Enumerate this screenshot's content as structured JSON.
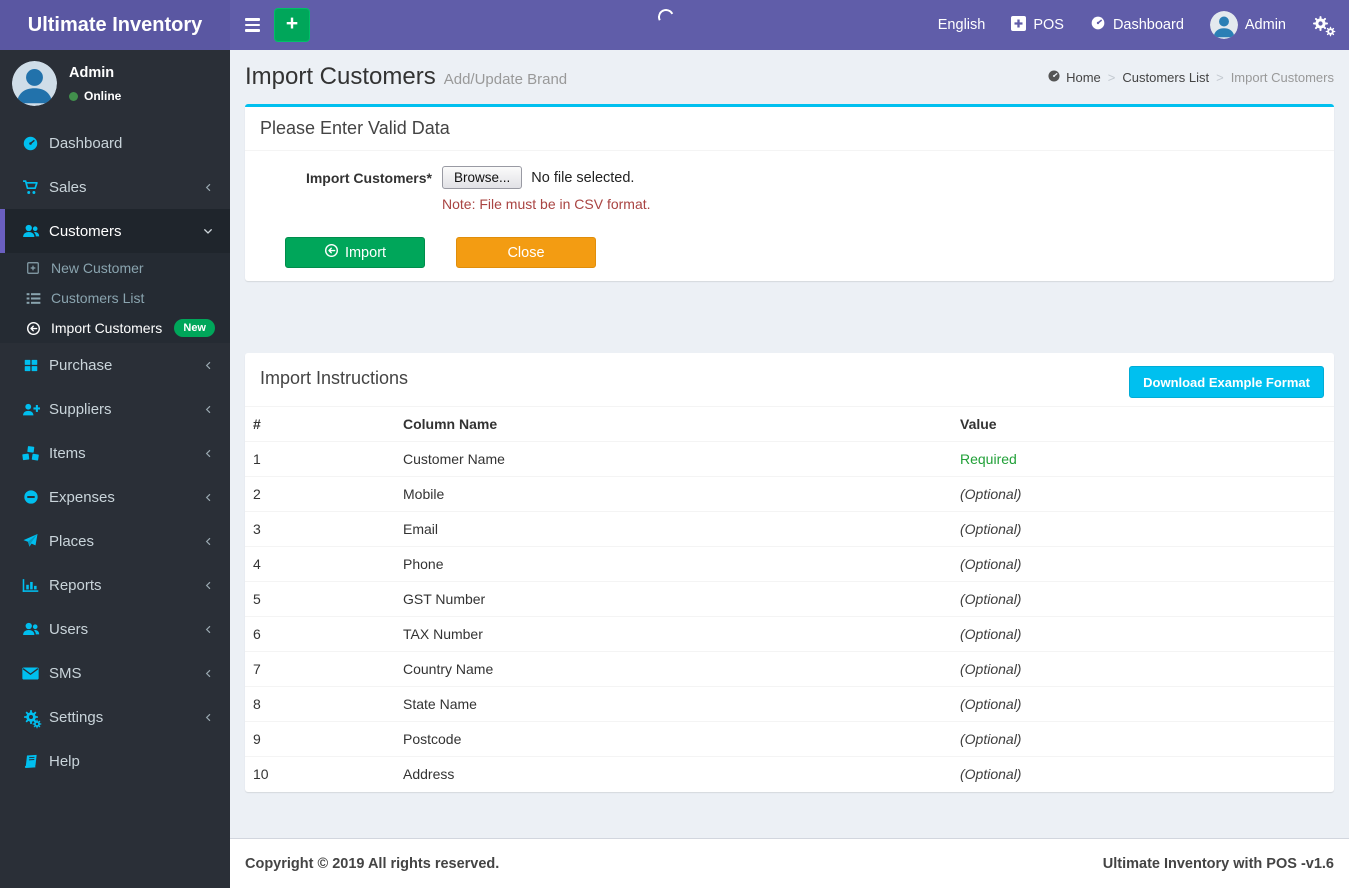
{
  "navbar": {
    "brand": "Ultimate Inventory",
    "language": "English",
    "pos_label": "POS",
    "dashboard_label": "Dashboard",
    "user_label": "Admin"
  },
  "sidebar": {
    "user": {
      "name": "Admin",
      "status": "Online"
    },
    "items": [
      {
        "label": "Dashboard"
      },
      {
        "label": "Sales"
      },
      {
        "label": "Customers",
        "children": [
          {
            "label": "New Customer"
          },
          {
            "label": "Customers List"
          },
          {
            "label": "Import Customers",
            "badge": "New"
          }
        ]
      },
      {
        "label": "Purchase"
      },
      {
        "label": "Suppliers"
      },
      {
        "label": "Items"
      },
      {
        "label": "Expenses"
      },
      {
        "label": "Places"
      },
      {
        "label": "Reports"
      },
      {
        "label": "Users"
      },
      {
        "label": "SMS"
      },
      {
        "label": "Settings"
      },
      {
        "label": "Help"
      }
    ]
  },
  "page": {
    "title": "Import Customers",
    "subtitle": "Add/Update Brand",
    "breadcrumb": {
      "home": "Home",
      "parent": "Customers List",
      "current": "Import Customers"
    }
  },
  "import_form": {
    "panel_title": "Please Enter Valid Data",
    "field_label": "Import Customers*",
    "browse_label": "Browse...",
    "file_status": "No file selected.",
    "note": "Note: File must be in CSV format.",
    "import_button": "Import",
    "close_button": "Close"
  },
  "instructions": {
    "panel_title": "Import Instructions",
    "download_button": "Download Example Format",
    "table": {
      "headers": [
        "#",
        "Column Name",
        "Value"
      ],
      "rows": [
        {
          "num": "1",
          "column_name": "Customer Name",
          "value": "Required"
        },
        {
          "num": "2",
          "column_name": "Mobile",
          "value": "(Optional)"
        },
        {
          "num": "3",
          "column_name": "Email",
          "value": "(Optional)"
        },
        {
          "num": "4",
          "column_name": "Phone",
          "value": "(Optional)"
        },
        {
          "num": "5",
          "column_name": "GST Number",
          "value": "(Optional)"
        },
        {
          "num": "6",
          "column_name": "TAX Number",
          "value": "(Optional)"
        },
        {
          "num": "7",
          "column_name": "Country Name",
          "value": "(Optional)"
        },
        {
          "num": "8",
          "column_name": "State Name",
          "value": "(Optional)"
        },
        {
          "num": "9",
          "column_name": "Postcode",
          "value": "(Optional)"
        },
        {
          "num": "10",
          "column_name": "Address",
          "value": "(Optional)"
        }
      ]
    }
  },
  "footer": {
    "left": "Copyright © 2019 All rights reserved.",
    "right": "Ultimate Inventory with POS -v1.6"
  },
  "colors": {
    "navbar_purple": "#605da9",
    "sidebar_dark": "#2a2f37",
    "icon_cyan": "#00bfef",
    "button_green": "#00a65a",
    "button_orange": "#f39c12",
    "info_cyan": "#00c0ef",
    "required_green": "#21a038",
    "note_red": "#a94442",
    "badge_green": "#00a65a",
    "active_border_purple": "#6a5fc0"
  }
}
